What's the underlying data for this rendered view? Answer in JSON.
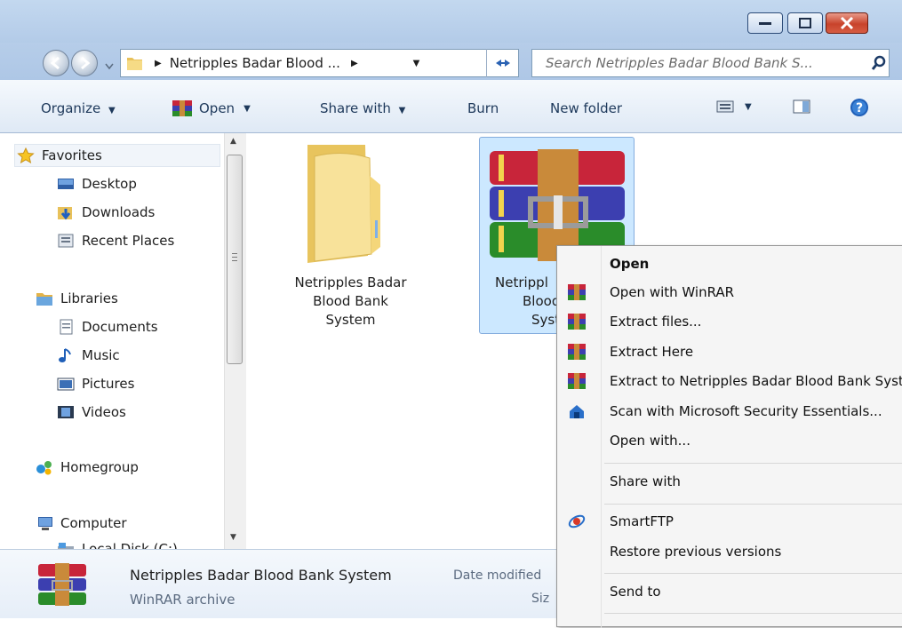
{
  "address": {
    "crumb": "Netripples Badar Blood ...",
    "search_placeholder": "Search Netripples Badar Blood Bank S..."
  },
  "toolbar": {
    "organize": "Organize",
    "open": "Open",
    "share_with": "Share with",
    "burn": "Burn",
    "new_folder": "New folder"
  },
  "nav": {
    "favorites": "Favorites",
    "desktop": "Desktop",
    "downloads": "Downloads",
    "recent": "Recent Places",
    "libraries": "Libraries",
    "documents": "Documents",
    "music": "Music",
    "pictures": "Pictures",
    "videos": "Videos",
    "homegroup": "Homegroup",
    "computer": "Computer",
    "local_disk": "Local Disk (C:)"
  },
  "files": {
    "folder_line1": "Netripples Badar",
    "folder_line2": "Blood Bank",
    "folder_line3": "System",
    "archive_line1": "Netrippl",
    "archive_line2": "Blood",
    "archive_line3": "Syst"
  },
  "details": {
    "name": "Netripples Badar Blood Bank System",
    "modified_label": "Date modified",
    "type": "WinRAR archive",
    "size_label": "Siz"
  },
  "context_menu": {
    "open": "Open",
    "open_winrar": "Open with WinRAR",
    "extract_files": "Extract files...",
    "extract_here": "Extract Here",
    "extract_to": "Extract to Netripples Badar Blood Bank System\\",
    "scan": "Scan with Microsoft Security Essentials...",
    "open_with": "Open with...",
    "share_with": "Share with",
    "smartftp": "SmartFTP",
    "restore": "Restore previous versions",
    "send_to": "Send to"
  },
  "colors": {
    "chrome": "#b6cde9",
    "selection": "#cce8ff",
    "menu_bg": "#f5f5f5",
    "close_red": "#c8432b"
  },
  "icons": [
    "folder-icon",
    "winrar-icon",
    "star-icon",
    "desktop-icon",
    "downloads-icon",
    "recent-places-icon",
    "libraries-icon",
    "documents-icon",
    "music-icon",
    "pictures-icon",
    "videos-icon",
    "homegroup-icon",
    "computer-icon",
    "disk-icon",
    "search-icon",
    "refresh-icon",
    "help-icon",
    "views-icon",
    "preview-pane-icon",
    "shield-icon",
    "smartftp-icon"
  ]
}
